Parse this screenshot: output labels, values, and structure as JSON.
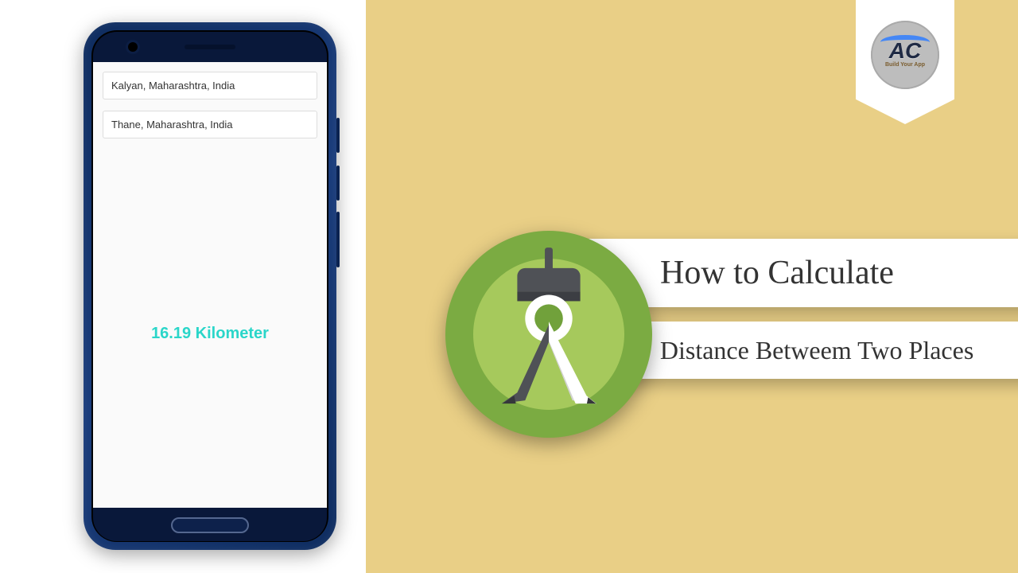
{
  "phone": {
    "input_origin": "Kalyan, Maharashtra, India",
    "input_destination": "Thane, Maharashtra, India",
    "result_text": "16.19 Kilometer"
  },
  "title": {
    "line1": "How to Calculate",
    "line2": "Distance Betweem Two Places"
  },
  "badge": {
    "logo_text": "AC",
    "subtitle": "Build Your App"
  }
}
